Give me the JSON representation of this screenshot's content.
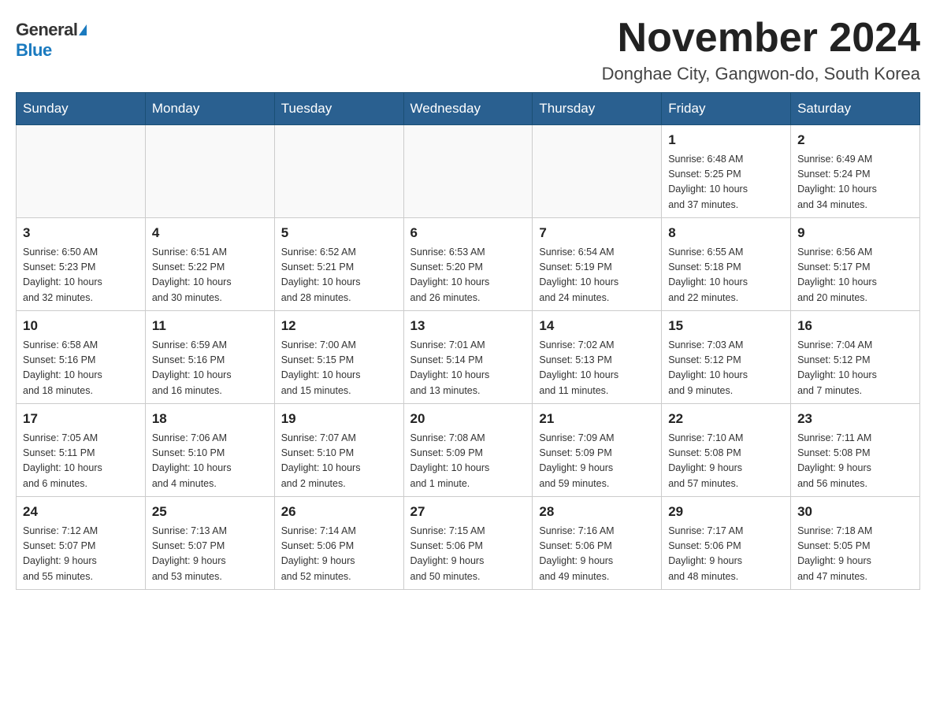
{
  "logo": {
    "general": "General",
    "blue": "Blue"
  },
  "title": "November 2024",
  "subtitle": "Donghae City, Gangwon-do, South Korea",
  "days_header": [
    "Sunday",
    "Monday",
    "Tuesday",
    "Wednesday",
    "Thursday",
    "Friday",
    "Saturday"
  ],
  "weeks": [
    [
      {
        "day": "",
        "info": ""
      },
      {
        "day": "",
        "info": ""
      },
      {
        "day": "",
        "info": ""
      },
      {
        "day": "",
        "info": ""
      },
      {
        "day": "",
        "info": ""
      },
      {
        "day": "1",
        "info": "Sunrise: 6:48 AM\nSunset: 5:25 PM\nDaylight: 10 hours\nand 37 minutes."
      },
      {
        "day": "2",
        "info": "Sunrise: 6:49 AM\nSunset: 5:24 PM\nDaylight: 10 hours\nand 34 minutes."
      }
    ],
    [
      {
        "day": "3",
        "info": "Sunrise: 6:50 AM\nSunset: 5:23 PM\nDaylight: 10 hours\nand 32 minutes."
      },
      {
        "day": "4",
        "info": "Sunrise: 6:51 AM\nSunset: 5:22 PM\nDaylight: 10 hours\nand 30 minutes."
      },
      {
        "day": "5",
        "info": "Sunrise: 6:52 AM\nSunset: 5:21 PM\nDaylight: 10 hours\nand 28 minutes."
      },
      {
        "day": "6",
        "info": "Sunrise: 6:53 AM\nSunset: 5:20 PM\nDaylight: 10 hours\nand 26 minutes."
      },
      {
        "day": "7",
        "info": "Sunrise: 6:54 AM\nSunset: 5:19 PM\nDaylight: 10 hours\nand 24 minutes."
      },
      {
        "day": "8",
        "info": "Sunrise: 6:55 AM\nSunset: 5:18 PM\nDaylight: 10 hours\nand 22 minutes."
      },
      {
        "day": "9",
        "info": "Sunrise: 6:56 AM\nSunset: 5:17 PM\nDaylight: 10 hours\nand 20 minutes."
      }
    ],
    [
      {
        "day": "10",
        "info": "Sunrise: 6:58 AM\nSunset: 5:16 PM\nDaylight: 10 hours\nand 18 minutes."
      },
      {
        "day": "11",
        "info": "Sunrise: 6:59 AM\nSunset: 5:16 PM\nDaylight: 10 hours\nand 16 minutes."
      },
      {
        "day": "12",
        "info": "Sunrise: 7:00 AM\nSunset: 5:15 PM\nDaylight: 10 hours\nand 15 minutes."
      },
      {
        "day": "13",
        "info": "Sunrise: 7:01 AM\nSunset: 5:14 PM\nDaylight: 10 hours\nand 13 minutes."
      },
      {
        "day": "14",
        "info": "Sunrise: 7:02 AM\nSunset: 5:13 PM\nDaylight: 10 hours\nand 11 minutes."
      },
      {
        "day": "15",
        "info": "Sunrise: 7:03 AM\nSunset: 5:12 PM\nDaylight: 10 hours\nand 9 minutes."
      },
      {
        "day": "16",
        "info": "Sunrise: 7:04 AM\nSunset: 5:12 PM\nDaylight: 10 hours\nand 7 minutes."
      }
    ],
    [
      {
        "day": "17",
        "info": "Sunrise: 7:05 AM\nSunset: 5:11 PM\nDaylight: 10 hours\nand 6 minutes."
      },
      {
        "day": "18",
        "info": "Sunrise: 7:06 AM\nSunset: 5:10 PM\nDaylight: 10 hours\nand 4 minutes."
      },
      {
        "day": "19",
        "info": "Sunrise: 7:07 AM\nSunset: 5:10 PM\nDaylight: 10 hours\nand 2 minutes."
      },
      {
        "day": "20",
        "info": "Sunrise: 7:08 AM\nSunset: 5:09 PM\nDaylight: 10 hours\nand 1 minute."
      },
      {
        "day": "21",
        "info": "Sunrise: 7:09 AM\nSunset: 5:09 PM\nDaylight: 9 hours\nand 59 minutes."
      },
      {
        "day": "22",
        "info": "Sunrise: 7:10 AM\nSunset: 5:08 PM\nDaylight: 9 hours\nand 57 minutes."
      },
      {
        "day": "23",
        "info": "Sunrise: 7:11 AM\nSunset: 5:08 PM\nDaylight: 9 hours\nand 56 minutes."
      }
    ],
    [
      {
        "day": "24",
        "info": "Sunrise: 7:12 AM\nSunset: 5:07 PM\nDaylight: 9 hours\nand 55 minutes."
      },
      {
        "day": "25",
        "info": "Sunrise: 7:13 AM\nSunset: 5:07 PM\nDaylight: 9 hours\nand 53 minutes."
      },
      {
        "day": "26",
        "info": "Sunrise: 7:14 AM\nSunset: 5:06 PM\nDaylight: 9 hours\nand 52 minutes."
      },
      {
        "day": "27",
        "info": "Sunrise: 7:15 AM\nSunset: 5:06 PM\nDaylight: 9 hours\nand 50 minutes."
      },
      {
        "day": "28",
        "info": "Sunrise: 7:16 AM\nSunset: 5:06 PM\nDaylight: 9 hours\nand 49 minutes."
      },
      {
        "day": "29",
        "info": "Sunrise: 7:17 AM\nSunset: 5:06 PM\nDaylight: 9 hours\nand 48 minutes."
      },
      {
        "day": "30",
        "info": "Sunrise: 7:18 AM\nSunset: 5:05 PM\nDaylight: 9 hours\nand 47 minutes."
      }
    ]
  ]
}
